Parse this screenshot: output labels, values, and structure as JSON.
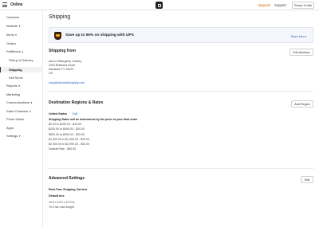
{
  "topbar": {
    "brand": "Online",
    "upgrade": "Upgrade",
    "support": "Support",
    "setup_guide": "Setup Guide"
  },
  "sidebar": {
    "items": [
      {
        "label": "Overview"
      },
      {
        "label": "Website",
        "caret": "▼"
      },
      {
        "label": "Items",
        "caret": "▼"
      },
      {
        "label": "Orders"
      },
      {
        "label": "Fulfillment",
        "caret": "▲"
      },
      {
        "label": "Pickup & Delivery"
      },
      {
        "label": "Shipping"
      },
      {
        "label": "Self Serve"
      },
      {
        "label": "Reports",
        "caret": "▼"
      },
      {
        "label": "Marketing"
      },
      {
        "label": "Communications",
        "caret": "▼"
      },
      {
        "label": "Sales Channels",
        "caret": "▼"
      },
      {
        "label": "Photo Studio"
      },
      {
        "label": "Apps"
      },
      {
        "label": "Settings",
        "caret": "▼"
      }
    ]
  },
  "page": {
    "title": "Shipping",
    "promo": {
      "text": "Save up to 55% on shipping with UPS",
      "more_info": "More info ▾"
    },
    "ship_from": {
      "title": "Shipping from",
      "edit_button": "Edit Address",
      "name": "Aaron Willoughby Jewelry",
      "street": "2320 Britannia Road",
      "city": "Sarasota, FL 34231",
      "country": "US",
      "email": "shop@aaronwilloughby.com"
    },
    "regions": {
      "title": "Destination Regions & Rates",
      "add_button": "Add Region",
      "country": "United States",
      "edit_link": "Edit",
      "rates_heading": "Shipping Rates will be determined by the price of your final order",
      "rates": [
        "$0.00 to $199.00 - $10.00",
        "$200.00 to $499.00 - $20.00",
        "$500.00 to $999.00 - $29.00",
        "$1,000.00 to $1,999.00 - $39.00",
        "$2,000.00 to $2,999.00 - $53.00",
        "Default Rate - $60.00"
      ]
    },
    "advanced": {
      "title": "Advanced Settings",
      "edit_button": "Edit",
      "carriers_label": "Real-Time Shipping Carriers",
      "default_box_label": "Default box",
      "box_dimensions": "10.0 x 10.0 x 10.0 in.",
      "max_weight": "70.0 lbs max weight"
    }
  }
}
